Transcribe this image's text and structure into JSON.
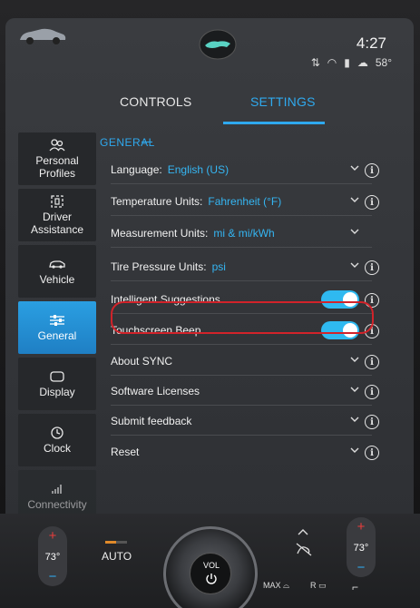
{
  "status": {
    "time": "4:27",
    "temperature": "58°"
  },
  "tabs": {
    "controls": "CONTROLS",
    "settings": "SETTINGS"
  },
  "sidebar": {
    "items": [
      {
        "label_line1": "Personal",
        "label_line2": "Profiles",
        "icon": "profiles-icon"
      },
      {
        "label_line1": "Driver",
        "label_line2": "Assistance",
        "icon": "driver-assist-icon"
      },
      {
        "label_line1": "Vehicle",
        "label_line2": "",
        "icon": "vehicle-icon"
      },
      {
        "label_line1": "General",
        "label_line2": "",
        "icon": "sliders-icon"
      },
      {
        "label_line1": "Display",
        "label_line2": "",
        "icon": "display-icon"
      },
      {
        "label_line1": "Clock",
        "label_line2": "",
        "icon": "clock-icon"
      },
      {
        "label_line1": "Connectivity",
        "label_line2": "",
        "icon": "signal-icon"
      }
    ]
  },
  "section": {
    "title": "GENERAL"
  },
  "rows": [
    {
      "label": "Language:",
      "value": "English (US)"
    },
    {
      "label": "Temperature Units:",
      "value": "Fahrenheit (°F)"
    },
    {
      "label": "Measurement Units:",
      "value": "mi & mi/kWh"
    },
    {
      "label": "Tire Pressure Units:",
      "value": "psi"
    },
    {
      "label": "Intelligent Suggestions",
      "toggle": "on"
    },
    {
      "label": "Touchscreen Beep",
      "toggle": "on"
    },
    {
      "label": "About SYNC"
    },
    {
      "label": "Software Licenses"
    },
    {
      "label": "Submit feedback"
    },
    {
      "label": "Reset"
    }
  ],
  "climate": {
    "left_temp": "73°",
    "right_temp": "73°",
    "auto_label": "AUTO",
    "vol_label": "VOL",
    "max_label": "MAX",
    "rear_label": "R"
  },
  "colors": {
    "accent": "#2fa9ee",
    "highlight": "#d2232a",
    "toggle_on": "#2fb9f0"
  }
}
